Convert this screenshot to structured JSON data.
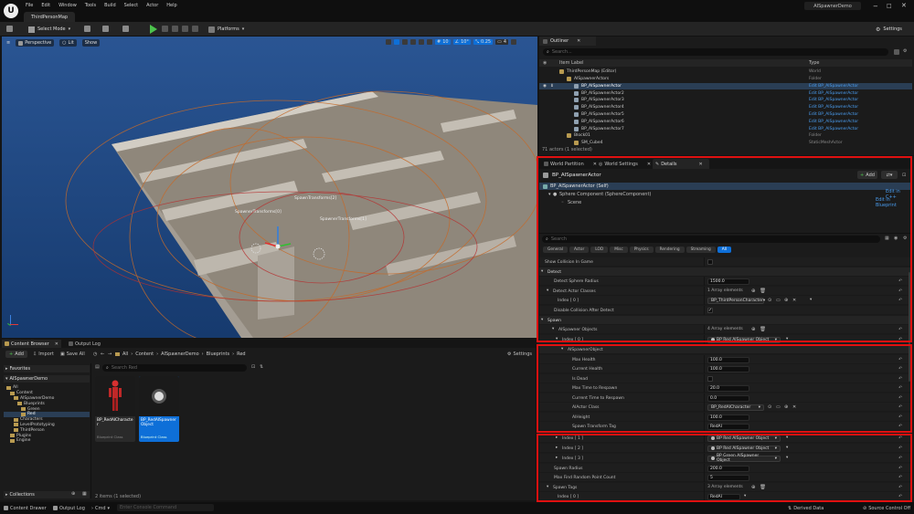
{
  "app": {
    "level_tab": "ThirdPersonMap",
    "menu": [
      "File",
      "Edit",
      "Window",
      "Tools",
      "Build",
      "Select",
      "Actor",
      "Help"
    ],
    "project": "AISpawnerDemo"
  },
  "toolbar": {
    "select_mode": "Select Mode",
    "platforms": "Platforms",
    "settings": "Settings"
  },
  "viewport": {
    "perspective": "Perspective",
    "lit": "Lit",
    "show": "Show",
    "snap_grid": "10",
    "snap_angle": "10°",
    "snap_scale": "0.25",
    "cam_speed": "4",
    "label_a": "SpawnerTransforms[0]",
    "label_b": "SpawnerTransforms[1]",
    "label_c": "SpawnTransforms[2]"
  },
  "outliner": {
    "title": "Outliner",
    "search_placeholder": "Search...",
    "col_label": "Item Label",
    "col_type": "Type",
    "rows": [
      {
        "label": "ThirdPersonMap (Editor)",
        "type": "World",
        "link": false,
        "indent": 0,
        "selected": false
      },
      {
        "label": "AISpawnerActors",
        "type": "Folder",
        "link": false,
        "indent": 1,
        "selected": false
      },
      {
        "label": "BP_AISpawnerActor",
        "type": "Edit BP_AISpawnerActor",
        "link": true,
        "indent": 2,
        "selected": true
      },
      {
        "label": "BP_AISpawnerActor2",
        "type": "Edit BP_AISpawnerActor",
        "link": true,
        "indent": 2,
        "selected": false
      },
      {
        "label": "BP_AISpawnerActor3",
        "type": "Edit BP_AISpawnerActor",
        "link": true,
        "indent": 2,
        "selected": false
      },
      {
        "label": "BP_AISpawnerActor4",
        "type": "Edit BP_AISpawnerActor",
        "link": true,
        "indent": 2,
        "selected": false
      },
      {
        "label": "BP_AISpawnerActor5",
        "type": "Edit BP_AISpawnerActor",
        "link": true,
        "indent": 2,
        "selected": false
      },
      {
        "label": "BP_AISpawnerActor6",
        "type": "Edit BP_AISpawnerActor",
        "link": true,
        "indent": 2,
        "selected": false
      },
      {
        "label": "BP_AISpawnerActor7",
        "type": "Edit BP_AISpawnerActor",
        "link": true,
        "indent": 2,
        "selected": false
      },
      {
        "label": "Block01",
        "type": "Folder",
        "link": false,
        "indent": 1,
        "selected": false
      },
      {
        "label": "SM_Cube4",
        "type": "StaticMeshActor",
        "link": false,
        "indent": 2,
        "selected": false
      }
    ],
    "status": "71 actors (1 selected)"
  },
  "details": {
    "tab_wp": "World Partition",
    "tab_ws": "World Settings",
    "tab_details": "Details",
    "actor_name": "BP_AISpawnerActor",
    "add": "Add",
    "comp_self": "BP_AISpawnerActor (Self)",
    "comp_sphere": "Sphere Component (SphereComponent)",
    "comp_scene": "Scene",
    "edit_cpp": "Edit in C++",
    "edit_bp": "Edit in Blueprint",
    "search_placeholder": "Search",
    "filters": [
      "General",
      "Actor",
      "LOD",
      "Misc",
      "Physics",
      "Rendering",
      "Streaming",
      "All"
    ],
    "show_collision": "Show Collision In Game",
    "cat_detect": "Detect",
    "detect_radius": "Detect Sphere Radius",
    "detect_radius_val": "1500.0",
    "detect_classes": "Detect Actor Classes",
    "detect_classes_count": "1 Array elements",
    "index0": "Index [ 0 ]",
    "detect_class_val": "BP_ThirdPersonCharacter",
    "disable_collision": "Disable Collision After Detect",
    "cat_spawn": "Spawn",
    "aispawner_objects": "AISpawner Objects",
    "objects_count": "4 Array elements",
    "obj0_val": "BP Red AISpawner Object",
    "aispawner_object": "AISpawnerObject",
    "max_health": "Max Health",
    "max_health_val": "100.0",
    "current_health": "Current Health",
    "current_health_val": "100.0",
    "is_dead": "Is Dead",
    "max_respawn": "Max Time to Respawn",
    "max_respawn_val": "20.0",
    "cur_respawn": "Current Time to Respawn",
    "cur_respawn_val": "0.0",
    "aiactor_class": "AIActor Class",
    "aiactor_class_val": "BP_RedAICharacter",
    "aiheight": "AIHeight",
    "aiheight_val": "100.0",
    "spawn_tag": "Spawn Transform Tag",
    "spawn_tag_val": "RedAI",
    "index1": "Index [ 1 ]",
    "obj1_val": "BP Red AISpawner Object",
    "index2": "Index [ 2 ]",
    "obj2_val": "BP Red AISpawner Object",
    "index3": "Index [ 3 ]",
    "obj3_val": "BP Green AISpawner Object",
    "spawn_radius": "Spawn Radius",
    "spawn_radius_val": "200.0",
    "max_find": "Max Find Random Point Count",
    "max_find_val": "5",
    "spawn_tags": "Spawn Tags",
    "spawn_tags_count": "3 Array elements",
    "spawn_tags_idx0": "Index [ 0 ]",
    "spawn_tags_val0": "RedAI"
  },
  "content": {
    "tab_cb": "Content Browser",
    "tab_log": "Output Log",
    "add": "Add",
    "import": "Import",
    "save_all": "Save All",
    "settings": "Settings",
    "breadcrumbs": [
      "All",
      "Content",
      "AISpawnerDemo",
      "Blueprints",
      "Red"
    ],
    "favorites": "Favorites",
    "project": "AISpawnerDemo",
    "search_placeholder": "Search Red",
    "tree": [
      {
        "label": "All",
        "indent": 0
      },
      {
        "label": "Content",
        "indent": 1
      },
      {
        "label": "AISpawnerDemo",
        "indent": 2
      },
      {
        "label": "Blueprints",
        "indent": 3
      },
      {
        "label": "Green",
        "indent": 4
      },
      {
        "label": "Red",
        "indent": 4
      },
      {
        "label": "Characters",
        "indent": 2
      },
      {
        "label": "LevelPrototyping",
        "indent": 2
      },
      {
        "label": "ThirdPerson",
        "indent": 2
      },
      {
        "label": "Plugins",
        "indent": 1
      },
      {
        "label": "Engine",
        "indent": 1
      }
    ],
    "assets": [
      {
        "name": "BP_RedAICharacter",
        "type": "Blueprint Class",
        "selected": false
      },
      {
        "name": "BP_RedAISpawnerObject",
        "type": "Blueprint Class",
        "selected": true
      }
    ],
    "collections": "Collections",
    "items": "2 items (1 selected)"
  },
  "statusbar": {
    "drawer": "Content Drawer",
    "log": "Output Log",
    "cmd": "Cmd",
    "cmd_placeholder": "Enter Console Command",
    "derived": "Derived Data",
    "source": "Source Control Off"
  },
  "colors": {
    "accent": "#0e6fd8",
    "highlight_box": "#e01010",
    "selected_row": "#2a3e55",
    "link": "#4a9df0"
  }
}
